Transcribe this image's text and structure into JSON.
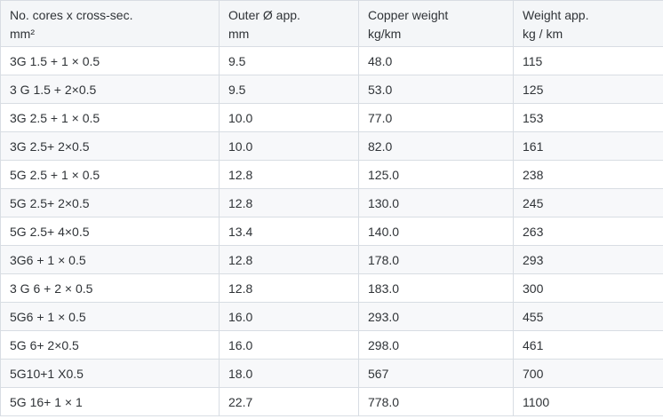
{
  "table": {
    "headers": [
      {
        "line1": "No. cores x cross-sec.",
        "line2": "mm²"
      },
      {
        "line1": "Outer Ø app.",
        "line2": "mm"
      },
      {
        "line1": "Copper weight",
        "line2": "kg/km"
      },
      {
        "line1": "Weight app.",
        "line2": "kg / km"
      }
    ],
    "rows": [
      [
        "3G 1.5 + 1 × 0.5",
        "9.5",
        "48.0",
        "115"
      ],
      [
        "3 G 1.5 + 2×0.5",
        "9.5",
        "53.0",
        "125"
      ],
      [
        "3G 2.5 + 1 × 0.5",
        "10.0",
        "77.0",
        "153"
      ],
      [
        "3G 2.5+ 2×0.5",
        "10.0",
        "82.0",
        "161"
      ],
      [
        "5G 2.5 + 1 × 0.5",
        "12.8",
        "125.0",
        "238"
      ],
      [
        "5G 2.5+ 2×0.5",
        "12.8",
        "130.0",
        "245"
      ],
      [
        "5G 2.5+ 4×0.5",
        "13.4",
        "140.0",
        "263"
      ],
      [
        "3G6 + 1 × 0.5",
        "12.8",
        "178.0",
        "293"
      ],
      [
        "3 G 6 + 2 × 0.5",
        "12.8",
        "183.0",
        "300"
      ],
      [
        "5G6 + 1 × 0.5",
        "16.0",
        "293.0",
        "455"
      ],
      [
        "5G 6+ 2×0.5",
        "16.0",
        "298.0",
        "461"
      ],
      [
        "5G10+1 X0.5",
        "18.0",
        "567",
        "700"
      ],
      [
        "5G 16+ 1 × 1",
        "22.7",
        "778.0",
        "1100"
      ]
    ]
  }
}
